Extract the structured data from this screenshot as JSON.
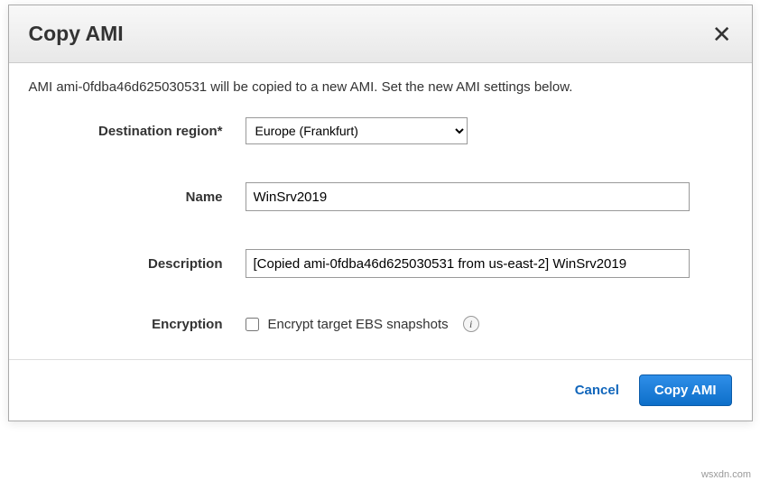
{
  "dialog": {
    "title": "Copy AMI",
    "intro": "AMI ami-0fdba46d625030531 will be copied to a new AMI. Set the new AMI settings below."
  },
  "form": {
    "region_label": "Destination region*",
    "region_value": "Europe (Frankfurt)",
    "name_label": "Name",
    "name_value": "WinSrv2019",
    "description_label": "Description",
    "description_value": "[Copied ami-0fdba46d625030531 from us-east-2] WinSrv2019",
    "encryption_label": "Encryption",
    "encryption_checkbox_label": "Encrypt target EBS snapshots"
  },
  "footer": {
    "cancel_label": "Cancel",
    "submit_label": "Copy AMI"
  },
  "watermark": "wsxdn.com"
}
